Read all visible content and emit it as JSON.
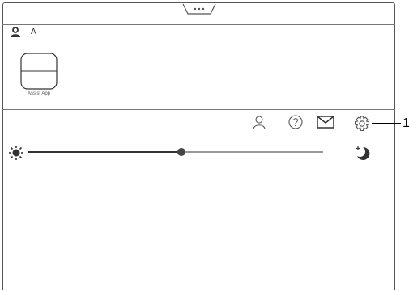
{
  "status_bar": {
    "icon": "pull-down-tab-icon"
  },
  "user": {
    "name": "A",
    "icon": "user-icon"
  },
  "apps": [
    {
      "label": "Assist App",
      "icon": "app-tile-icon"
    }
  ],
  "quick_settings": [
    {
      "id": "account",
      "icon": "person-icon"
    },
    {
      "id": "help",
      "icon": "help-icon"
    },
    {
      "id": "messages",
      "icon": "mail-icon"
    },
    {
      "id": "settings",
      "icon": "gear-icon"
    }
  ],
  "callout": {
    "number": "1"
  },
  "frontlight": {
    "level": 0.52,
    "min_icon": "sun-icon",
    "max_icon": "moon-icon"
  }
}
